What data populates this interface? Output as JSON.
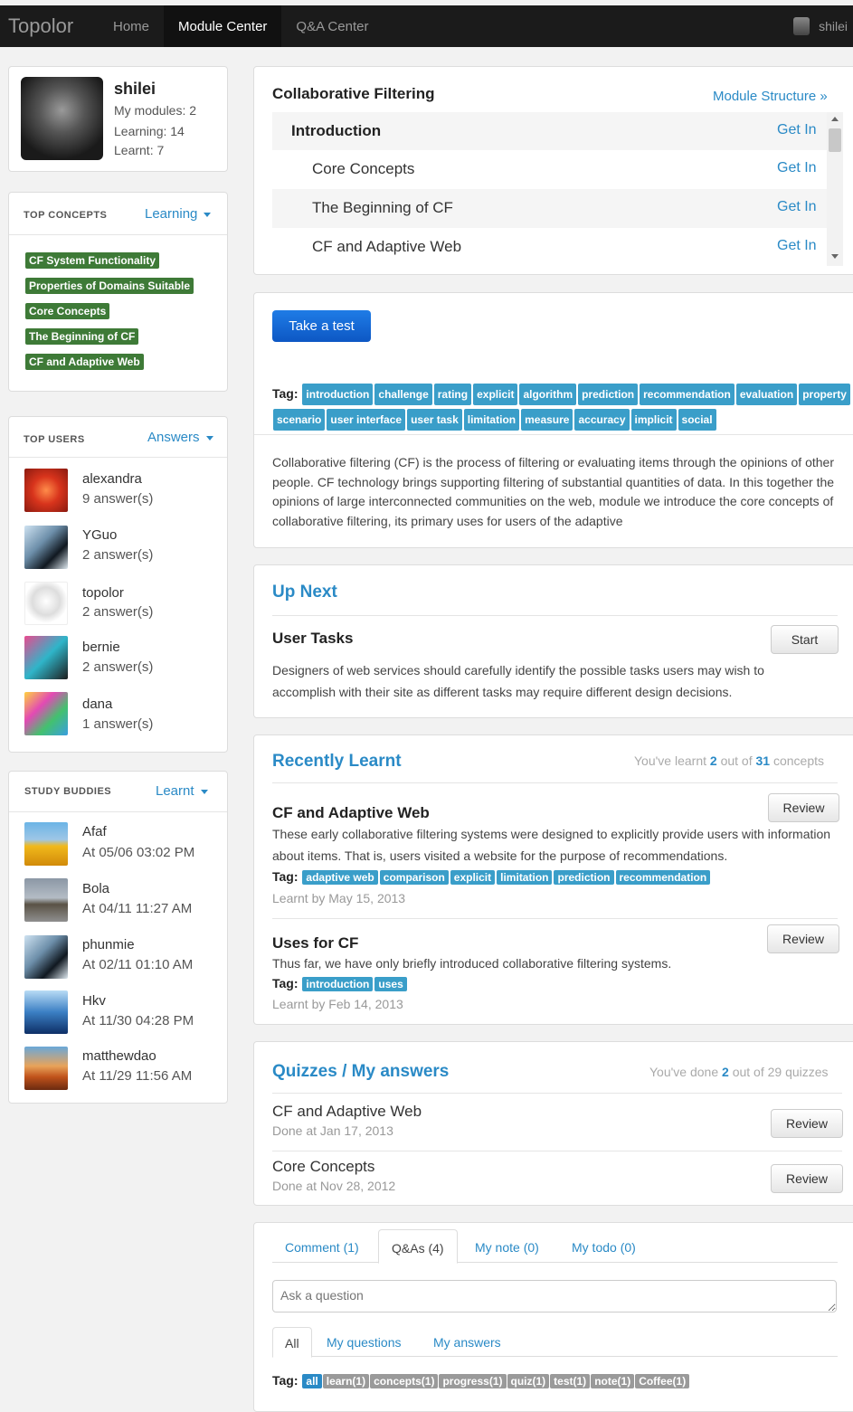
{
  "nav": {
    "brand": "Topolor",
    "home": "Home",
    "module_center": "Module Center",
    "qa_center": "Q&A Center",
    "user": "shilei"
  },
  "profile": {
    "name": "shilei",
    "modules": "My modules: 2",
    "learning": "Learning: 14",
    "learnt": "Learnt: 7"
  },
  "top_concepts": {
    "heading": "TOP CONCEPTS",
    "filter": "Learning",
    "items": [
      "CF System Functionality",
      "Properties of Domains Suitable",
      "Core Concepts",
      "The Beginning of CF",
      "CF and Adaptive Web"
    ]
  },
  "top_users": {
    "heading": "TOP USERS",
    "filter": "Answers",
    "items": [
      {
        "name": "alexandra",
        "sub": "9 answer(s)"
      },
      {
        "name": "YGuo",
        "sub": "2 answer(s)"
      },
      {
        "name": "topolor",
        "sub": "2 answer(s)"
      },
      {
        "name": "bernie",
        "sub": "2 answer(s)"
      },
      {
        "name": "dana",
        "sub": "1 answer(s)"
      }
    ]
  },
  "study_buddies": {
    "heading": "STUDY BUDDIES",
    "filter": "Learnt",
    "items": [
      {
        "name": "Afaf",
        "sub": "At 05/06 03:02 PM"
      },
      {
        "name": "Bola",
        "sub": "At 04/11 11:27 AM"
      },
      {
        "name": "phunmie",
        "sub": "At 02/11 01:10 AM"
      },
      {
        "name": "Hkv",
        "sub": "At 11/30 04:28 PM"
      },
      {
        "name": "matthewdao",
        "sub": "At 11/29 11:56 AM"
      }
    ]
  },
  "module": {
    "title": "Collaborative Filtering",
    "structure_link": "Module Structure »",
    "rows": [
      {
        "label": "Introduction",
        "action": "Get In"
      },
      {
        "label": "Core Concepts",
        "action": "Get In"
      },
      {
        "label": "The Beginning of CF",
        "action": "Get In"
      },
      {
        "label": "CF and Adaptive Web",
        "action": "Get In"
      }
    ]
  },
  "test": {
    "button": "Take a test",
    "tag_label": "Tag:",
    "tags": [
      "introduction",
      "challenge",
      "rating",
      "explicit",
      "algorithm",
      "prediction",
      "recommendation",
      "evaluation",
      "property",
      "scenario",
      "user interface",
      "user task",
      "limitation",
      "measure",
      "accuracy",
      "implicit",
      "social"
    ],
    "description": "Collaborative filtering (CF) is the process of filtering or evaluating items through the opinions of other people. CF technology brings supporting filtering of substantial quantities of data. In this together the opinions of large interconnected communities on the web, module we introduce the core concepts of collaborative filtering, its primary uses for users of the adaptive"
  },
  "up_next": {
    "heading": "Up Next",
    "title": "User Tasks",
    "button": "Start",
    "text": "Designers of web services should carefully identify the possible tasks users may wish to accomplish with their site as different tasks may require different design decisions."
  },
  "recently": {
    "heading": "Recently Learnt",
    "stat_pre": "You've learnt ",
    "stat_done": "2",
    "stat_mid": " out of ",
    "stat_total": "31",
    "stat_post": " concepts",
    "items": [
      {
        "title": "CF and Adaptive Web",
        "text": "These early collaborative filtering systems were designed to explicitly provide users with information about items. That is, users visited a website for the purpose of recommendations.",
        "tags": [
          "adaptive web",
          "comparison",
          "explicit",
          "limitation",
          "prediction",
          "recommendation"
        ],
        "date": "Learnt by May 15, 2013",
        "button": "Review"
      },
      {
        "title": "Uses for CF",
        "text": "Thus far, we have only briefly introduced collaborative filtering systems.",
        "tags": [
          "introduction",
          "uses"
        ],
        "date": "Learnt by Feb 14, 2013",
        "button": "Review"
      }
    ]
  },
  "quizzes": {
    "heading_a": "Quizzes",
    "heading_sep": " / ",
    "heading_b": "My answers",
    "stat_pre": "You've done ",
    "stat_done": "2",
    "stat_post": " out of 29 quizzes",
    "items": [
      {
        "title": "CF and Adaptive Web",
        "date": "Done at Jan 17, 2013",
        "button": "Review"
      },
      {
        "title": "Core Concepts",
        "date": "Done at Nov 28, 2012",
        "button": "Review"
      }
    ]
  },
  "discussion": {
    "tabs": [
      "Comment (1)",
      "Q&As (4)",
      "My note (0)",
      "My todo (0)"
    ],
    "placeholder": "Ask a question",
    "subtabs": [
      "All",
      "My questions",
      "My answers"
    ],
    "tag_label": "Tag:",
    "tags": [
      "all",
      "learn(1)",
      "concepts(1)",
      "progress(1)",
      "quiz(1)",
      "test(1)",
      "note(1)",
      "Coffee(1)"
    ]
  },
  "colors": {
    "accent": "#2a8ac6",
    "green_tag": "#3e7a37",
    "blue_tag": "#3a9ec9",
    "primary_button": "#1a68d6",
    "topbar": "#1b1b1b"
  }
}
